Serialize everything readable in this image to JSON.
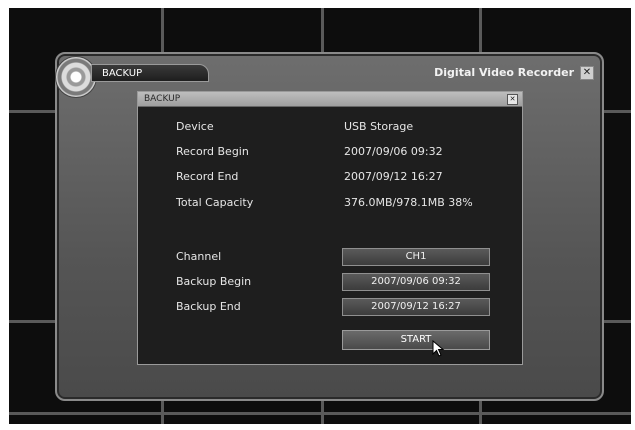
{
  "outer_window": {
    "tab_label": "BACKUP",
    "app_title": "Digital Video Recorder",
    "close_glyph": "✕"
  },
  "dialog": {
    "title": "BACKUP",
    "close_glyph": "✕",
    "info": [
      {
        "label": "Device",
        "value": "USB Storage"
      },
      {
        "label": "Record Begin",
        "value": "2007/09/06 09:32"
      },
      {
        "label": "Record End",
        "value": "2007/09/12 16:27"
      },
      {
        "label": "Total Capacity",
        "value": "376.0MB/978.1MB 38%"
      }
    ],
    "settings": [
      {
        "label": "Channel",
        "value": "CH1"
      },
      {
        "label": "Backup Begin",
        "value": "2007/09/06 09:32"
      },
      {
        "label": "Backup End",
        "value": "2007/09/12 16:27"
      }
    ],
    "start_label": "START"
  }
}
